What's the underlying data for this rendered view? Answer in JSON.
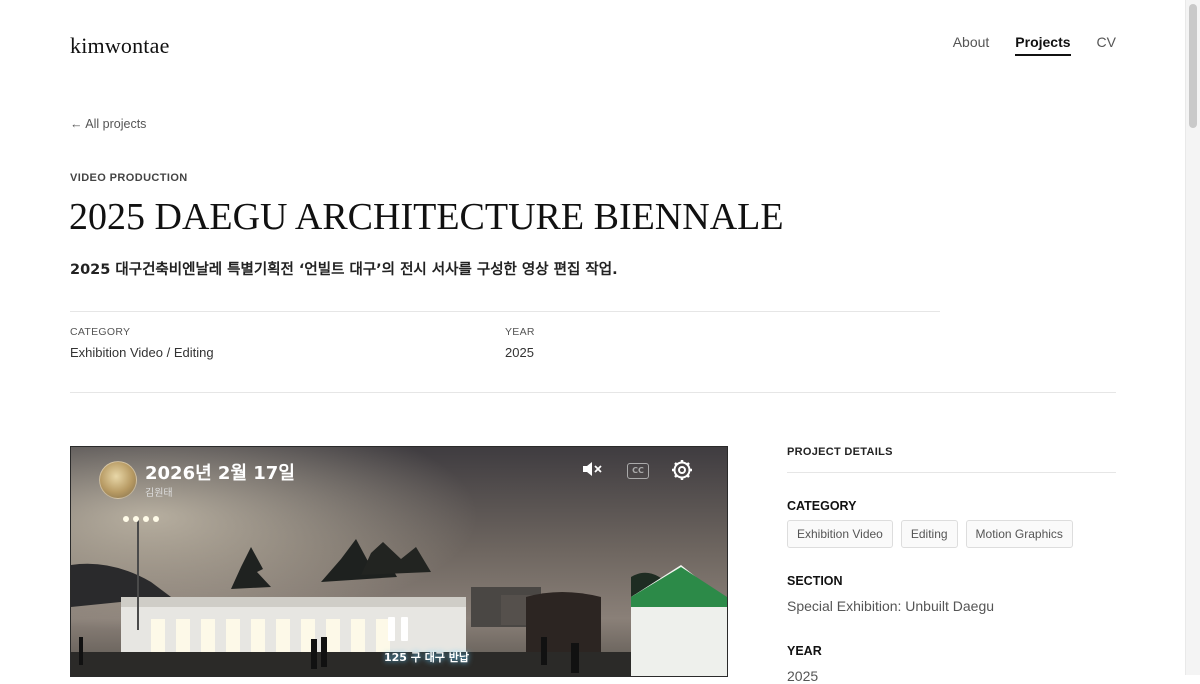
{
  "header": {
    "logo": "kimwontae",
    "nav": [
      {
        "label": "About",
        "active": false
      },
      {
        "label": "Projects",
        "active": true
      },
      {
        "label": "CV",
        "active": false
      }
    ]
  },
  "back_link": "← All projects",
  "project": {
    "eyebrow": "VIDEO PRODUCTION",
    "title": "2025 DAEGU ARCHITECTURE BIENNALE",
    "subtitle": "2025 대구건축비엔날레 특별기획전 ‘언빌트 대구’의 전시 서사를 구성한 영상 편집 작업.",
    "meta": {
      "category_label": "CATEGORY",
      "category_value": "Exhibition Video / Editing",
      "year_label": "YEAR",
      "year_value": "2025"
    }
  },
  "video": {
    "title": "2026년 2월 17일",
    "channel": "김원태",
    "mute_icon": "speaker-muted-icon",
    "cc_label": "CC",
    "settings_icon": "gear-icon",
    "caption": "125 구 대구 반납"
  },
  "details": {
    "heading": "PROJECT DETAILS",
    "category_label": "CATEGORY",
    "tags": [
      "Exhibition Video",
      "Editing",
      "Motion Graphics"
    ],
    "section_label": "SECTION",
    "section_value": "Special Exhibition: Unbuilt Daegu",
    "year_label": "YEAR",
    "year_value": "2025"
  }
}
